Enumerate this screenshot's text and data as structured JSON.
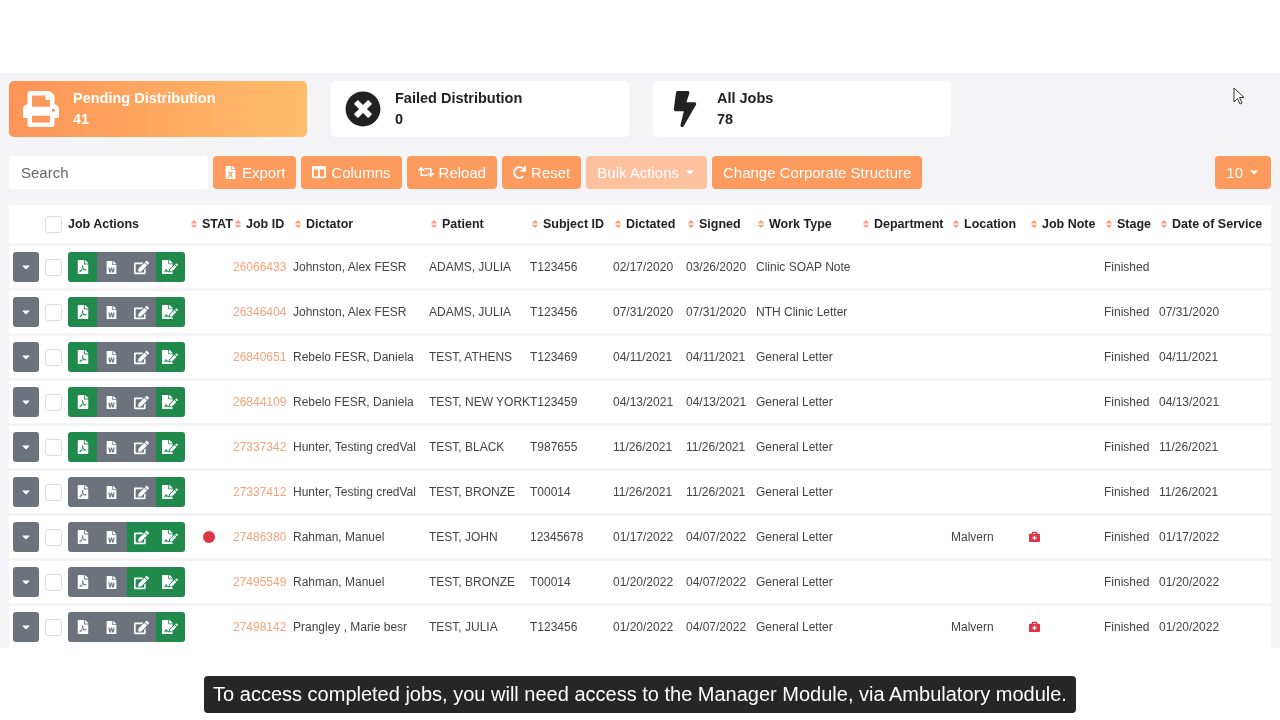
{
  "cards": [
    {
      "kind": "pending",
      "title": "Pending Distribution",
      "count": "41",
      "selected": true
    },
    {
      "kind": "failed",
      "title": "Failed Distribution",
      "count": "0",
      "selected": false
    },
    {
      "kind": "all",
      "title": "All Jobs",
      "count": "78",
      "selected": false
    }
  ],
  "search": {
    "placeholder": "Search"
  },
  "toolbar_buttons": [
    {
      "kind": "export",
      "label": "Export",
      "disabled": false
    },
    {
      "kind": "columns",
      "label": "Columns",
      "disabled": false
    },
    {
      "kind": "reload",
      "label": "Reload",
      "disabled": false
    },
    {
      "kind": "reset",
      "label": "Reset",
      "disabled": false
    },
    {
      "kind": "dropdown",
      "label": "Bulk Actions",
      "disabled": true
    },
    {
      "kind": "plain",
      "label": "Change Corporate Structure",
      "disabled": false
    }
  ],
  "page_size": {
    "value": "10"
  },
  "table": {
    "select_all": {
      "checked": false
    },
    "columns": [
      {
        "label": "Job Actions",
        "sortable": false
      },
      {
        "label": "STAT",
        "sortable": true
      },
      {
        "label": "Job ID",
        "sortable": true
      },
      {
        "label": "Dictator",
        "sortable": true
      },
      {
        "label": "Patient",
        "sortable": true
      },
      {
        "label": "Subject ID",
        "sortable": true
      },
      {
        "label": "Dictated",
        "sortable": true
      },
      {
        "label": "Signed",
        "sortable": true
      },
      {
        "label": "Work Type",
        "sortable": true
      },
      {
        "label": "Department",
        "sortable": true
      },
      {
        "label": "Location",
        "sortable": true
      },
      {
        "label": "Job Note",
        "sortable": true
      },
      {
        "label": "Stage",
        "sortable": true
      },
      {
        "label": "Date of Service",
        "sortable": true
      }
    ],
    "rows": [
      {
        "checked": false,
        "actions": [
          {
            "kind": "pdf",
            "enabled": true
          },
          {
            "kind": "word",
            "enabled": false
          },
          {
            "kind": "edit",
            "enabled": false
          },
          {
            "kind": "sign",
            "enabled": true
          }
        ],
        "stat": false,
        "job_id": "26066433",
        "dictator": "Johnston, Alex FESR",
        "patient": "ADAMS, JULIA",
        "subject_id": "T123456",
        "dictated": "02/17/2020",
        "signed": "03/26/2020",
        "work_type": "Clinic SOAP Note",
        "job_note": false,
        "stage": "Finished"
      },
      {
        "checked": false,
        "actions": [
          {
            "kind": "pdf",
            "enabled": true
          },
          {
            "kind": "word",
            "enabled": false
          },
          {
            "kind": "edit",
            "enabled": false
          },
          {
            "kind": "sign",
            "enabled": true
          }
        ],
        "stat": false,
        "job_id": "26346404",
        "dictator": "Johnston, Alex FESR",
        "patient": "ADAMS, JULIA",
        "subject_id": "T123456",
        "dictated": "07/31/2020",
        "signed": "07/31/2020",
        "work_type": "NTH Clinic Letter",
        "job_note": false,
        "stage": "Finished",
        "date_of_service": "07/31/2020"
      },
      {
        "checked": false,
        "actions": [
          {
            "kind": "pdf",
            "enabled": true
          },
          {
            "kind": "word",
            "enabled": false
          },
          {
            "kind": "edit",
            "enabled": false
          },
          {
            "kind": "sign",
            "enabled": true
          }
        ],
        "stat": false,
        "job_id": "26840651",
        "dictator": "Rebelo FESR, Daniela",
        "patient": "TEST, ATHENS",
        "subject_id": "T123469",
        "dictated": "04/11/2021",
        "signed": "04/11/2021",
        "work_type": "General Letter",
        "job_note": false,
        "stage": "Finished",
        "date_of_service": "04/11/2021"
      },
      {
        "checked": false,
        "actions": [
          {
            "kind": "pdf",
            "enabled": true
          },
          {
            "kind": "word",
            "enabled": false
          },
          {
            "kind": "edit",
            "enabled": false
          },
          {
            "kind": "sign",
            "enabled": true
          }
        ],
        "stat": false,
        "job_id": "26844109",
        "dictator": "Rebelo FESR, Daniela",
        "patient": "TEST, NEW YORK",
        "subject_id": "T123459",
        "dictated": "04/13/2021",
        "signed": "04/13/2021",
        "work_type": "General Letter",
        "job_note": false,
        "stage": "Finished",
        "date_of_service": "04/13/2021"
      },
      {
        "checked": false,
        "actions": [
          {
            "kind": "pdf",
            "enabled": true
          },
          {
            "kind": "word",
            "enabled": false
          },
          {
            "kind": "edit",
            "enabled": false
          },
          {
            "kind": "sign",
            "enabled": true
          }
        ],
        "stat": false,
        "job_id": "27337342",
        "dictator": "Hunter, Testing credVal",
        "patient": "TEST, BLACK",
        "subject_id": "T987655",
        "dictated": "11/26/2021",
        "signed": "11/26/2021",
        "work_type": "General Letter",
        "job_note": false,
        "stage": "Finished",
        "date_of_service": "11/26/2021"
      },
      {
        "checked": false,
        "actions": [
          {
            "kind": "pdf",
            "enabled": false
          },
          {
            "kind": "word",
            "enabled": false
          },
          {
            "kind": "edit",
            "enabled": false
          },
          {
            "kind": "sign",
            "enabled": true
          }
        ],
        "stat": false,
        "job_id": "27337412",
        "dictator": "Hunter, Testing credVal",
        "patient": "TEST, BRONZE",
        "subject_id": "T00014",
        "dictated": "11/26/2021",
        "signed": "11/26/2021",
        "work_type": "General Letter",
        "job_note": false,
        "stage": "Finished",
        "date_of_service": "11/26/2021"
      },
      {
        "checked": false,
        "actions": [
          {
            "kind": "pdf",
            "enabled": false
          },
          {
            "kind": "word",
            "enabled": false
          },
          {
            "kind": "edit",
            "enabled": true
          },
          {
            "kind": "sign",
            "enabled": true
          }
        ],
        "stat": true,
        "job_id": "27486380",
        "dictator": "Rahman, Manuel",
        "patient": "TEST, JOHN",
        "subject_id": "12345678",
        "dictated": "01/17/2022",
        "signed": "04/07/2022",
        "work_type": "General Letter",
        "location": "Malvern",
        "job_note": true,
        "stage": "Finished",
        "date_of_service": "01/17/2022"
      },
      {
        "checked": false,
        "actions": [
          {
            "kind": "pdf",
            "enabled": false
          },
          {
            "kind": "word",
            "enabled": false
          },
          {
            "kind": "edit",
            "enabled": true
          },
          {
            "kind": "sign",
            "enabled": true
          }
        ],
        "stat": false,
        "job_id": "27495549",
        "dictator": "Rahman, Manuel",
        "patient": "TEST, BRONZE",
        "subject_id": "T00014",
        "dictated": "01/20/2022",
        "signed": "04/07/2022",
        "work_type": "General Letter",
        "job_note": false,
        "stage": "Finished",
        "date_of_service": "01/20/2022"
      },
      {
        "checked": false,
        "actions": [
          {
            "kind": "pdf",
            "enabled": false
          },
          {
            "kind": "word",
            "enabled": false
          },
          {
            "kind": "edit",
            "enabled": false
          },
          {
            "kind": "sign",
            "enabled": true
          }
        ],
        "stat": false,
        "job_id": "27498142",
        "dictator": "Prangley , Marie besr",
        "patient": "TEST, JULIA",
        "subject_id": "T123456",
        "dictated": "01/20/2022",
        "signed": "04/07/2022",
        "work_type": "General Letter",
        "location": "Malvern",
        "job_note": true,
        "stage": "Finished",
        "date_of_service": "01/20/2022"
      }
    ]
  },
  "caption": "To access completed jobs, you will need access to the Manager Module, via Ambulatory module."
}
